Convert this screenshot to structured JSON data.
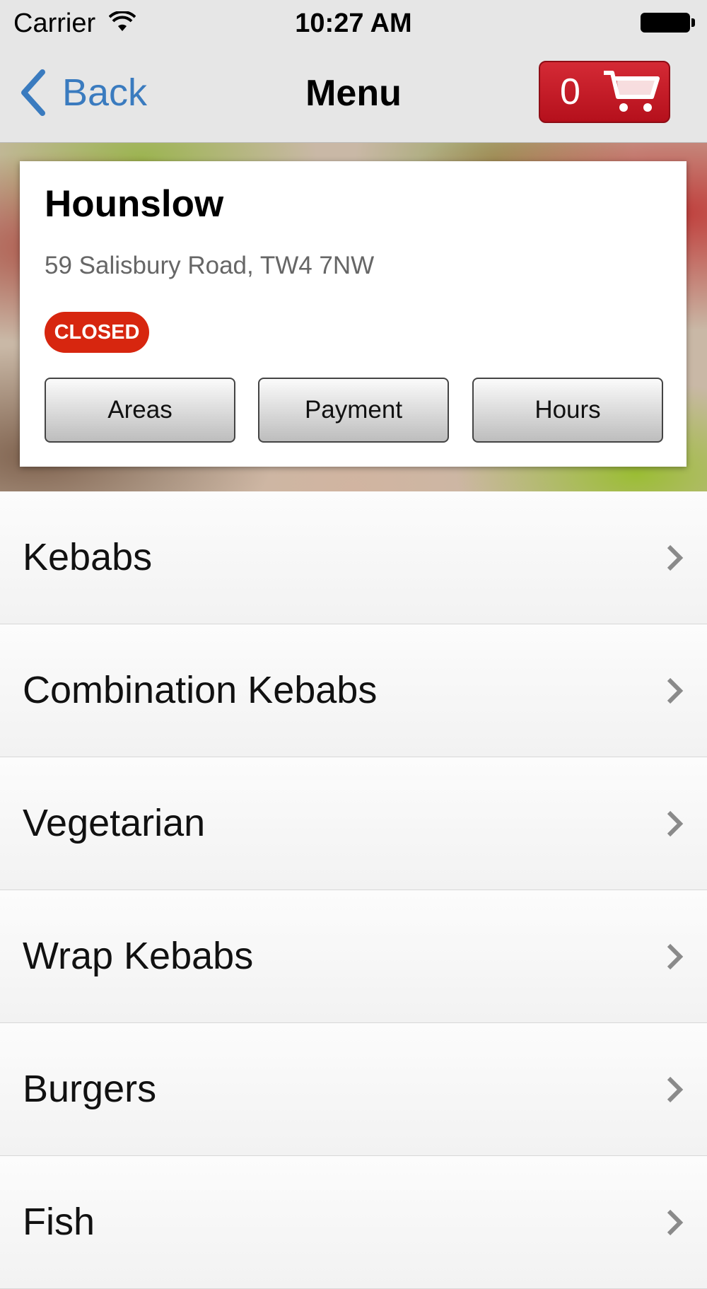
{
  "status_bar": {
    "carrier": "Carrier",
    "time": "10:27 AM",
    "icons": [
      "wifi-icon",
      "battery-icon"
    ]
  },
  "nav": {
    "back_label": "Back",
    "title": "Menu",
    "cart_count": "0",
    "colors": {
      "back": "#3a7bbf",
      "cart": "#c41e2a"
    }
  },
  "store": {
    "name": "Hounslow",
    "address": "59 Salisbury Road, TW4 7NW",
    "status": "CLOSED",
    "status_color": "#d7260f",
    "buttons": {
      "areas": "Areas",
      "payment": "Payment",
      "hours": "Hours"
    }
  },
  "menu": {
    "items": [
      {
        "label": "Kebabs"
      },
      {
        "label": "Combination Kebabs"
      },
      {
        "label": "Vegetarian"
      },
      {
        "label": "Wrap Kebabs"
      },
      {
        "label": "Burgers"
      },
      {
        "label": "Fish"
      }
    ]
  }
}
